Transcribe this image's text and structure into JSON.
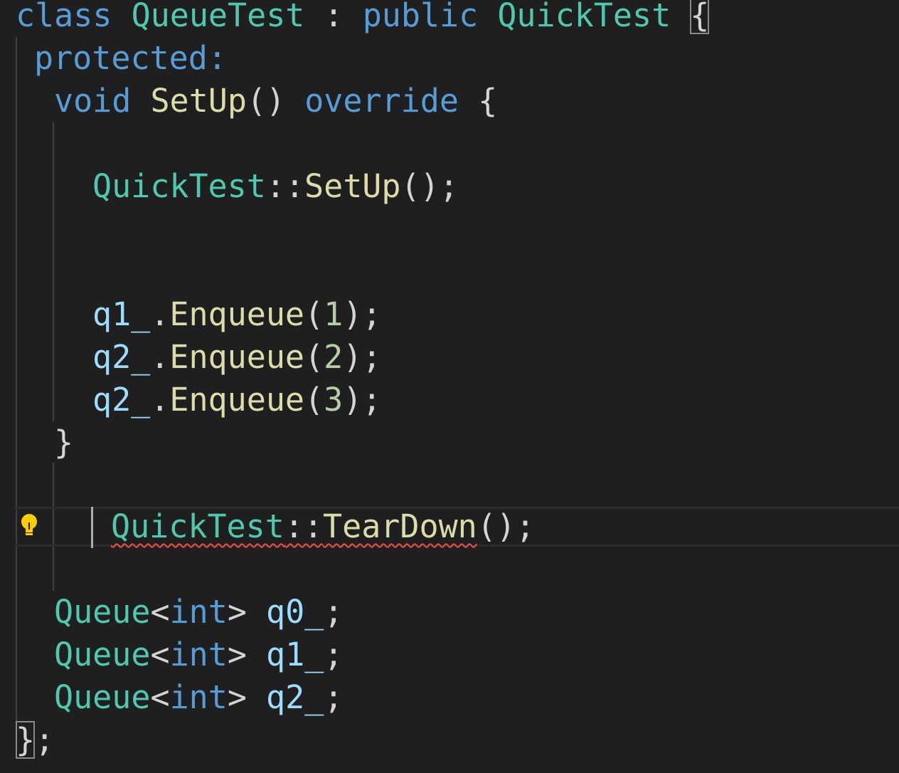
{
  "editor": {
    "theme_colors": {
      "background": "#1f1f1f",
      "keyword": "#569cd6",
      "type": "#4ec9b0",
      "function": "#dcdcaa",
      "variable": "#9cdcfe",
      "number": "#b5cea8",
      "punctuation": "#d4d4d4",
      "error_squiggle": "#f14c4c",
      "lightbulb": "#ffcc00"
    },
    "code": {
      "line1": {
        "kw_class": "class",
        "class_name": "QueueTest",
        "colon": " : ",
        "kw_public": "public",
        "base_class": "QuickTest",
        "open_brace": "{"
      },
      "line2": {
        "kw_protected": "protected:"
      },
      "line3": {
        "kw_void": "void",
        "fn_setup": "SetUp",
        "parens": "()",
        "kw_override": "override",
        "open_brace": "{"
      },
      "line5": {
        "type": "QuickTest",
        "scope": "::",
        "fn": "SetUp",
        "tail": "();"
      },
      "line8": {
        "var": "q1_",
        "dot": ".",
        "fn": "Enqueue",
        "open": "(",
        "num": "1",
        "close": ");"
      },
      "line9": {
        "var": "q2_",
        "dot": ".",
        "fn": "Enqueue",
        "open": "(",
        "num": "2",
        "close": ");"
      },
      "line10": {
        "var": "q2_",
        "dot": ".",
        "fn": "Enqueue",
        "open": "(",
        "num": "3",
        "close": ");"
      },
      "line11": {
        "close_brace": "}"
      },
      "line13": {
        "type": "QuickTest",
        "scope": "::",
        "fn": "TearDown",
        "tail": "();"
      },
      "line15": {
        "type": "Queue",
        "lt": "<",
        "kw_int": "int",
        "gt": ">",
        "var": "q0_",
        "semi": ";"
      },
      "line16": {
        "type": "Queue",
        "lt": "<",
        "kw_int": "int",
        "gt": ">",
        "var": "q1_",
        "semi": ";"
      },
      "line17": {
        "type": "Queue",
        "lt": "<",
        "kw_int": "int",
        "gt": ">",
        "var": "q2_",
        "semi": ";"
      },
      "line18": {
        "close_brace": "}",
        "semi": ";"
      }
    },
    "gutter": {
      "lightbulb_icon": "lightbulb-icon"
    }
  }
}
